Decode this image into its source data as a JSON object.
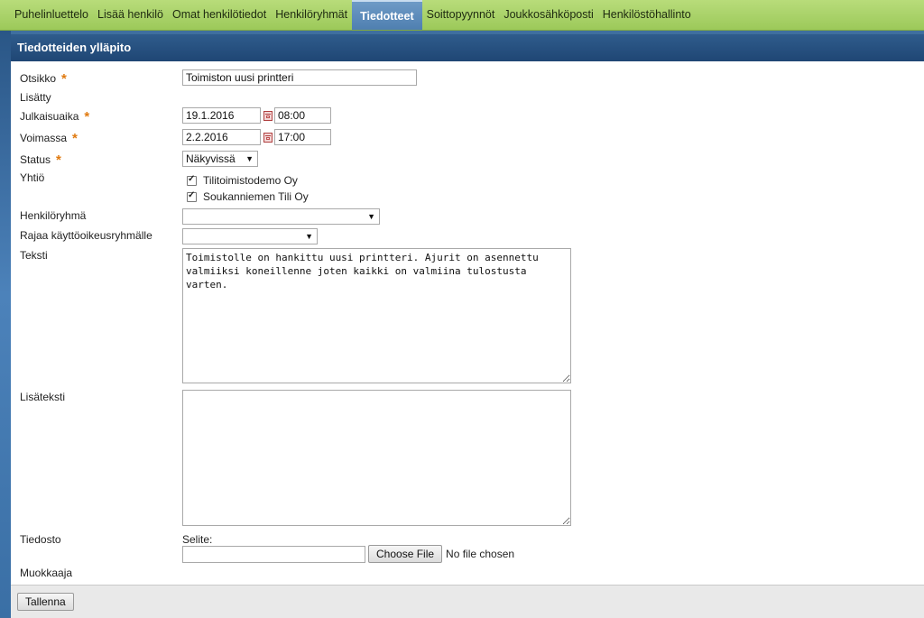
{
  "nav": {
    "items": [
      {
        "label": "Puhelinluettelo",
        "active": false
      },
      {
        "label": "Lisää henkilö",
        "active": false
      },
      {
        "label": "Omat henkilötiedot",
        "active": false
      },
      {
        "label": "Henkilöryhmät",
        "active": false
      },
      {
        "label": "Tiedotteet",
        "active": true
      },
      {
        "label": "Soittopyynnöt",
        "active": false
      },
      {
        "label": "Joukkosähköposti",
        "active": false
      },
      {
        "label": "Henkilöstöhallinto",
        "active": false
      }
    ]
  },
  "panel": {
    "title": "Tiedotteiden ylläpito"
  },
  "form": {
    "otsikko": {
      "label": "Otsikko",
      "value": "Toimiston uusi printteri"
    },
    "lisatty": {
      "label": "Lisätty"
    },
    "julkaisuaika": {
      "label": "Julkaisuaika",
      "date": "19.1.2016",
      "time": "08:00"
    },
    "voimassa": {
      "label": "Voimassa",
      "date": "2.2.2016",
      "time": "17:00"
    },
    "status": {
      "label": "Status",
      "value": "Näkyvissä"
    },
    "yhtio": {
      "label": "Yhtiö",
      "options": [
        {
          "label": "Tilitoimistodemo Oy",
          "checked": true
        },
        {
          "label": "Soukanniemen Tili Oy",
          "checked": true
        }
      ]
    },
    "henkiloryhma": {
      "label": "Henkilöryhmä",
      "value": ""
    },
    "rajaa": {
      "label": "Rajaa käyttöoikeusryhmälle",
      "value": ""
    },
    "teksti": {
      "label": "Teksti",
      "value": "Toimistolle on hankittu uusi printteri. Ajurit on asennettu valmiiksi koneillenne joten kaikki on valmiina tulostusta varten."
    },
    "lisateksti": {
      "label": "Lisäteksti",
      "value": ""
    },
    "tiedosto": {
      "label": "Tiedosto",
      "selite_label": "Selite:",
      "selite_value": "",
      "choose_label": "Choose File",
      "no_file": "No file chosen"
    },
    "muokkaaja": {
      "label": "Muokkaaja"
    }
  },
  "footer": {
    "save_label": "Tallenna"
  },
  "colors": {
    "nav_bg": "#9cc95a",
    "active_tab": "#5585b6",
    "header": "#274f80",
    "required_star": "#e07a10"
  }
}
